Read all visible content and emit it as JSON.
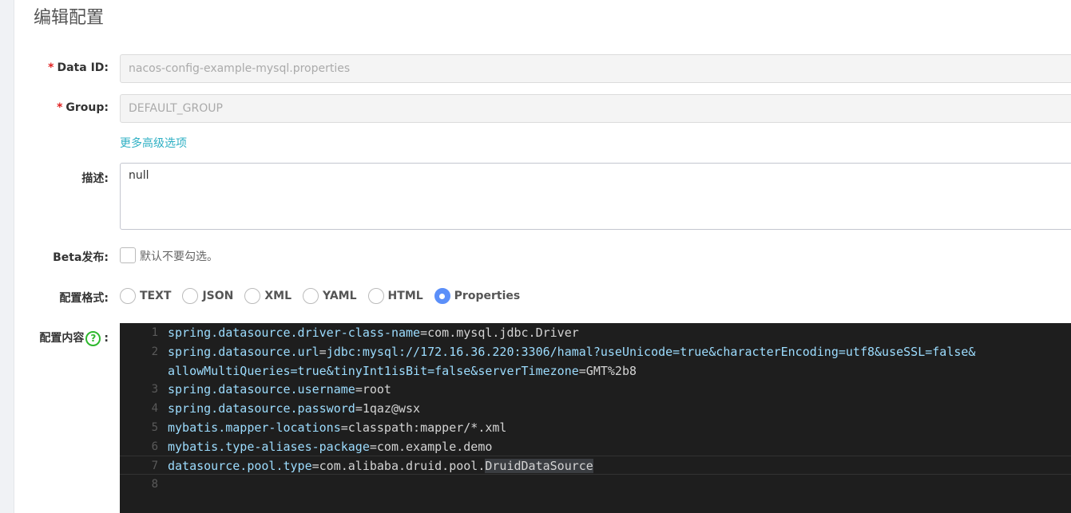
{
  "page": {
    "title": "编辑配置"
  },
  "form": {
    "data_id": {
      "label": "Data ID:",
      "value": "nacos-config-example-mysql.properties",
      "required": true
    },
    "group": {
      "label": "Group:",
      "value": "DEFAULT_GROUP",
      "required": true
    },
    "advanced_link": "更多高级选项",
    "description": {
      "label": "描述:",
      "value": "null"
    },
    "beta": {
      "label": "Beta发布:",
      "checkbox_label": "默认不要勾选。",
      "checked": false
    },
    "format": {
      "label": "配置格式:",
      "options": [
        "TEXT",
        "JSON",
        "XML",
        "YAML",
        "HTML",
        "Properties"
      ],
      "selected": "Properties"
    },
    "content": {
      "label": "配置内容",
      "help_icon_text": "?",
      "colon": ":"
    }
  },
  "editor": {
    "lines": [
      {
        "num": "1",
        "key": "spring.datasource.driver-class-name",
        "eq": "=",
        "value": "com.mysql.jdbc.Driver"
      },
      {
        "num": "2",
        "key": "spring.datasource.url",
        "eq": "=",
        "value": "jdbc:mysql://172.16.36.220:3306/hamal?useUnicode=true&characterEncoding=utf8&useSSL=false&"
      },
      {
        "num": "",
        "key": "allowMultiQueries=true&tinyInt1isBit=false&serverTimezone",
        "eq": "=",
        "value": "GMT%2b8"
      },
      {
        "num": "3",
        "key": "spring.datasource.username",
        "eq": "=",
        "value": "root"
      },
      {
        "num": "4",
        "key": "spring.datasource.password",
        "eq": "=",
        "value": "1qaz@wsx"
      },
      {
        "num": "5",
        "key": "mybatis.mapper-locations",
        "eq": "=",
        "value": "classpath:mapper/*.xml"
      },
      {
        "num": "6",
        "key": "mybatis.type-aliases-package",
        "eq": "=",
        "value": "com.example.demo"
      },
      {
        "num": "7",
        "key": "datasource.pool.type",
        "eq": "=",
        "value": "com.alibaba.druid.pool.",
        "selected_value": "DruidDataSource"
      },
      {
        "num": "8",
        "key": "",
        "eq": "",
        "value": ""
      }
    ]
  },
  "colors": {
    "accent": "#5b8ff9",
    "link": "#2fb0c4",
    "help": "#2eb82e",
    "editor_bg": "#1e1e1e",
    "key": "#9cdcfe",
    "required": "#e02020"
  }
}
